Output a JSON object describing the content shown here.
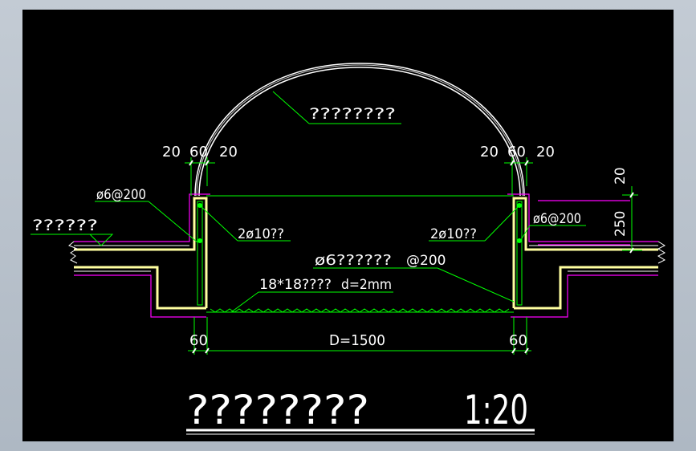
{
  "drawing": {
    "title_label": "????????",
    "scale_label": "1:20",
    "labels": {
      "dome_material": "????????",
      "ground_finish": "??????",
      "edge_dims_left": [
        "20",
        "60",
        "20"
      ],
      "edge_dims_right": [
        "20",
        "60",
        "20"
      ],
      "stirrup_left": "ø6@200",
      "stirrup_right": "ø6@200",
      "bars_left": "2ø10??",
      "bars_right": "2ø10??",
      "mesh": "ø6??????",
      "mesh_spacing": "@200",
      "steel_plate": "18*18????",
      "plate_thickness": "d=2mm",
      "dim_upper": "20",
      "dim_lower": "250",
      "wall_left": "60",
      "wall_right": "60",
      "diameter": "D=1500"
    },
    "colors": {
      "background": "#000000",
      "outline": "#ffffff",
      "leader": "#00ff00",
      "dimension": "#00ff00",
      "concrete": "#ffffa0",
      "waterproof": "#ff00ff",
      "text": "#ffffff"
    }
  }
}
